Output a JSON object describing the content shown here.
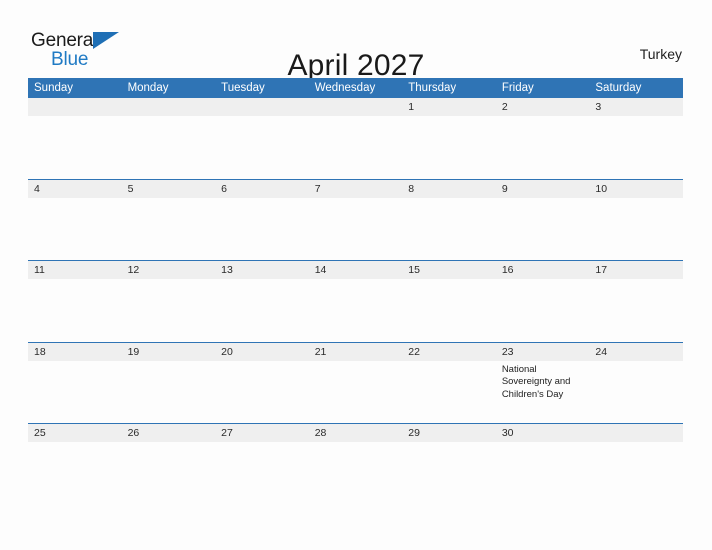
{
  "brand": {
    "name_part1": "General",
    "name_part2": "Blue",
    "flag_icon": "blue-triangle-flag-icon"
  },
  "header": {
    "title": "April 2027",
    "country": "Turkey"
  },
  "calendar": {
    "weekdays": [
      "Sunday",
      "Monday",
      "Tuesday",
      "Wednesday",
      "Thursday",
      "Friday",
      "Saturday"
    ],
    "colors": {
      "header_blue": "#2f74b5",
      "date_band_gray": "#efefef",
      "brand_blue": "#1f7ac4",
      "page_background": "#fdfdfd"
    },
    "weeks": [
      {
        "days": [
          {
            "date": "",
            "event": ""
          },
          {
            "date": "",
            "event": ""
          },
          {
            "date": "",
            "event": ""
          },
          {
            "date": "",
            "event": ""
          },
          {
            "date": "1",
            "event": ""
          },
          {
            "date": "2",
            "event": ""
          },
          {
            "date": "3",
            "event": ""
          }
        ]
      },
      {
        "days": [
          {
            "date": "4",
            "event": ""
          },
          {
            "date": "5",
            "event": ""
          },
          {
            "date": "6",
            "event": ""
          },
          {
            "date": "7",
            "event": ""
          },
          {
            "date": "8",
            "event": ""
          },
          {
            "date": "9",
            "event": ""
          },
          {
            "date": "10",
            "event": ""
          }
        ]
      },
      {
        "days": [
          {
            "date": "11",
            "event": ""
          },
          {
            "date": "12",
            "event": ""
          },
          {
            "date": "13",
            "event": ""
          },
          {
            "date": "14",
            "event": ""
          },
          {
            "date": "15",
            "event": ""
          },
          {
            "date": "16",
            "event": ""
          },
          {
            "date": "17",
            "event": ""
          }
        ]
      },
      {
        "days": [
          {
            "date": "18",
            "event": ""
          },
          {
            "date": "19",
            "event": ""
          },
          {
            "date": "20",
            "event": ""
          },
          {
            "date": "21",
            "event": ""
          },
          {
            "date": "22",
            "event": ""
          },
          {
            "date": "23",
            "event": "National Sovereignty and Children's Day"
          },
          {
            "date": "24",
            "event": ""
          }
        ]
      },
      {
        "days": [
          {
            "date": "25",
            "event": ""
          },
          {
            "date": "26",
            "event": ""
          },
          {
            "date": "27",
            "event": ""
          },
          {
            "date": "28",
            "event": ""
          },
          {
            "date": "29",
            "event": ""
          },
          {
            "date": "30",
            "event": ""
          },
          {
            "date": "",
            "event": ""
          }
        ]
      }
    ]
  }
}
